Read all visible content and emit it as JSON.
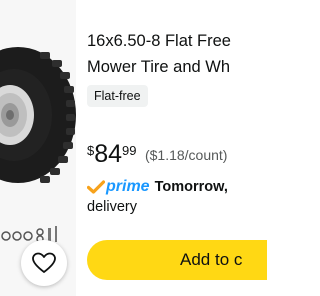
{
  "product": {
    "title_line1": "16x6.50-8 Flat Free",
    "title_line2": "Mower Tire and Wh",
    "badge": "Flat-free",
    "price_symbol": "$",
    "price_whole": "84",
    "price_fraction": "99",
    "unit_price": "($1.18/count)"
  },
  "delivery": {
    "prime_label": "prime",
    "day": "Tomorrow,",
    "suffix": "delivery"
  },
  "actions": {
    "add_to_cart_label": "Add to c"
  },
  "colors": {
    "prime_blue": "#1a98ff",
    "prime_check": "#f7a21b",
    "cart_yellow": "#ffd814",
    "badge_bg": "#f0f2f2",
    "unit_price_gray": "#565959"
  },
  "icons": {
    "favorite": "heart-icon",
    "prime_check": "check-icon"
  }
}
